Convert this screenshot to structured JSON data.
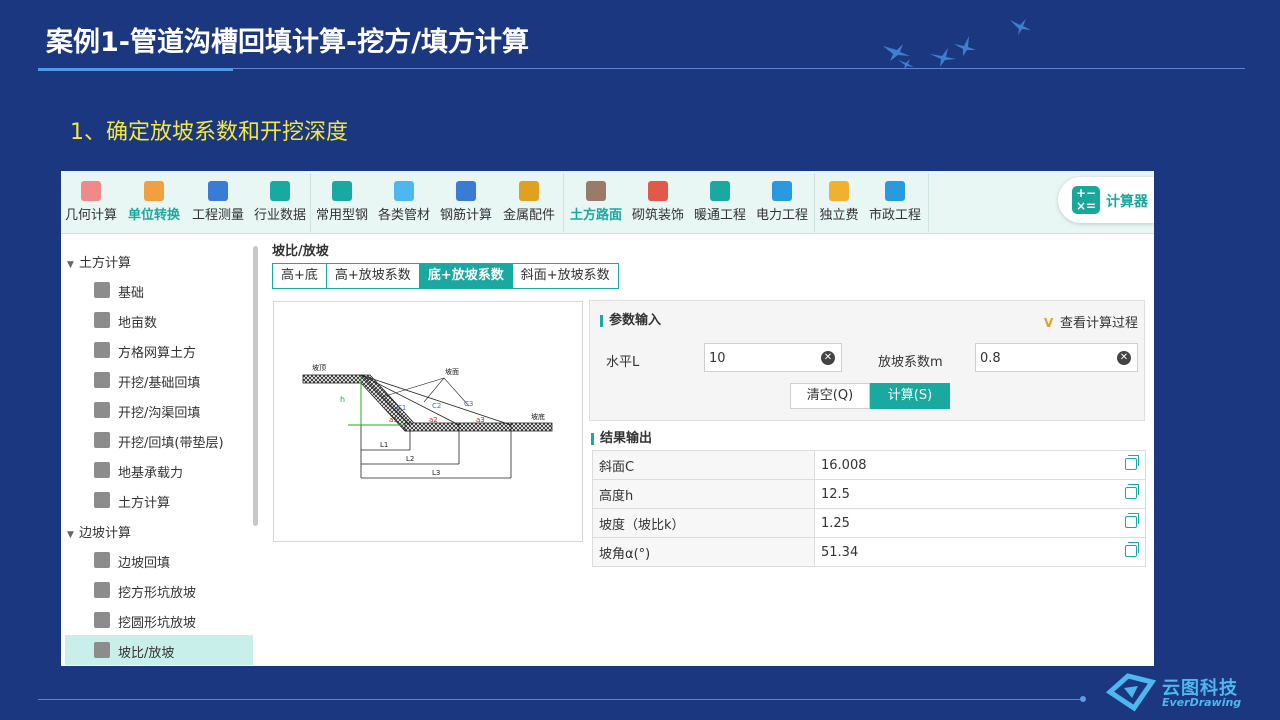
{
  "slide": {
    "title": "案例1-管道沟槽回填计算-挖方/填方计算",
    "step": "1、确定放坡系数和开挖深度"
  },
  "toolbar": {
    "items": [
      {
        "label": "几何计算",
        "icon": "cube-icon",
        "color": "#f08a8a"
      },
      {
        "label": "单位转换",
        "icon": "unit-convert-icon",
        "color": "#f0a040",
        "active": true
      },
      {
        "label": "工程测量",
        "icon": "axis-icon",
        "color": "#3a7bd5"
      },
      {
        "label": "行业数据",
        "icon": "bar-chart-icon",
        "color": "#1aa9a0"
      },
      {
        "label": "常用型钢",
        "icon": "tools-icon",
        "color": "#1aa9a0"
      },
      {
        "label": "各类管材",
        "icon": "pipe-icon",
        "color": "#4fb7f0"
      },
      {
        "label": "钢筋计算",
        "icon": "rebar-icon",
        "color": "#3a7bd5"
      },
      {
        "label": "金属配件",
        "icon": "fitting-icon",
        "color": "#e0a020"
      },
      {
        "label": "土方路面",
        "icon": "road-icon",
        "color": "#9a7b6a",
        "active": true
      },
      {
        "label": "砌筑装饰",
        "icon": "brick-icon",
        "color": "#e05a4a"
      },
      {
        "label": "暖通工程",
        "icon": "fan-icon",
        "color": "#1aa9a0"
      },
      {
        "label": "电力工程",
        "icon": "house-power-icon",
        "color": "#2a9ae0"
      },
      {
        "label": "独立费",
        "icon": "fee-chart-icon",
        "color": "#f0b030"
      },
      {
        "label": "市政工程",
        "icon": "municipal-icon",
        "color": "#2a9ae0"
      }
    ],
    "calculator": {
      "label": "计算器",
      "icon": "calculator-icon"
    }
  },
  "sidebar": {
    "groups": [
      {
        "label": "土方计算",
        "icon": "caret-down-icon"
      },
      {
        "label": "边坡计算",
        "icon": "caret-down-icon"
      }
    ],
    "items": [
      {
        "label": "基础",
        "icon": "foundation-icon"
      },
      {
        "label": "地亩数",
        "icon": "grid-area-icon"
      },
      {
        "label": "方格网算土方",
        "icon": "grid-icon"
      },
      {
        "label": "开挖/基础回填",
        "icon": "excavate-icon"
      },
      {
        "label": "开挖/沟渠回填",
        "icon": "trench-icon"
      },
      {
        "label": "开挖/回填(带垫层)",
        "icon": "cushion-icon"
      },
      {
        "label": "地基承载力",
        "icon": "bearing-vip-icon"
      },
      {
        "label": "土方计算",
        "icon": "earthwork-icon"
      },
      {
        "label": "边坡回填",
        "icon": "slope-fill-icon"
      },
      {
        "label": "挖方形坑放坡",
        "icon": "square-pit-icon"
      },
      {
        "label": "挖圆形坑放坡",
        "icon": "round-pit-icon"
      },
      {
        "label": "坡比/放坡",
        "icon": "slope-ratio-icon",
        "active": true
      }
    ]
  },
  "panel": {
    "title": "坡比/放坡",
    "tabs": [
      {
        "label": "高+底"
      },
      {
        "label": "高+放坡系数"
      },
      {
        "label": "底+放坡系数",
        "active": true
      },
      {
        "label": "斜面+放坡系数"
      }
    ]
  },
  "diagram": {
    "top_label": "坡顶",
    "face_label": "坡面",
    "bottom_label": "坡底",
    "h": "h",
    "c1": "C1",
    "c2": "C2",
    "c3": "C3",
    "a1": "a1",
    "a2": "a2",
    "a3": "a3",
    "l1": "L1",
    "l2": "L2",
    "l3": "L3"
  },
  "params": {
    "title": "参数输入",
    "view_process": "查看计算过程",
    "horizontal_label": "水平L",
    "horizontal_value": "10",
    "slope_coef_label": "放坡系数m",
    "slope_coef_value": "0.8",
    "clear_button": "清空(Q)",
    "calc_button": "计算(S)"
  },
  "results": {
    "title": "结果输出",
    "rows": [
      {
        "label": "斜面C",
        "value": "16.008"
      },
      {
        "label": "高度h",
        "value": "12.5"
      },
      {
        "label": "坡度（坡比k）",
        "value": "1.25"
      },
      {
        "label": "坡角α(°)",
        "value": "51.34"
      }
    ]
  },
  "brand": {
    "cn": "云图科技",
    "en": "EverDrawing"
  }
}
